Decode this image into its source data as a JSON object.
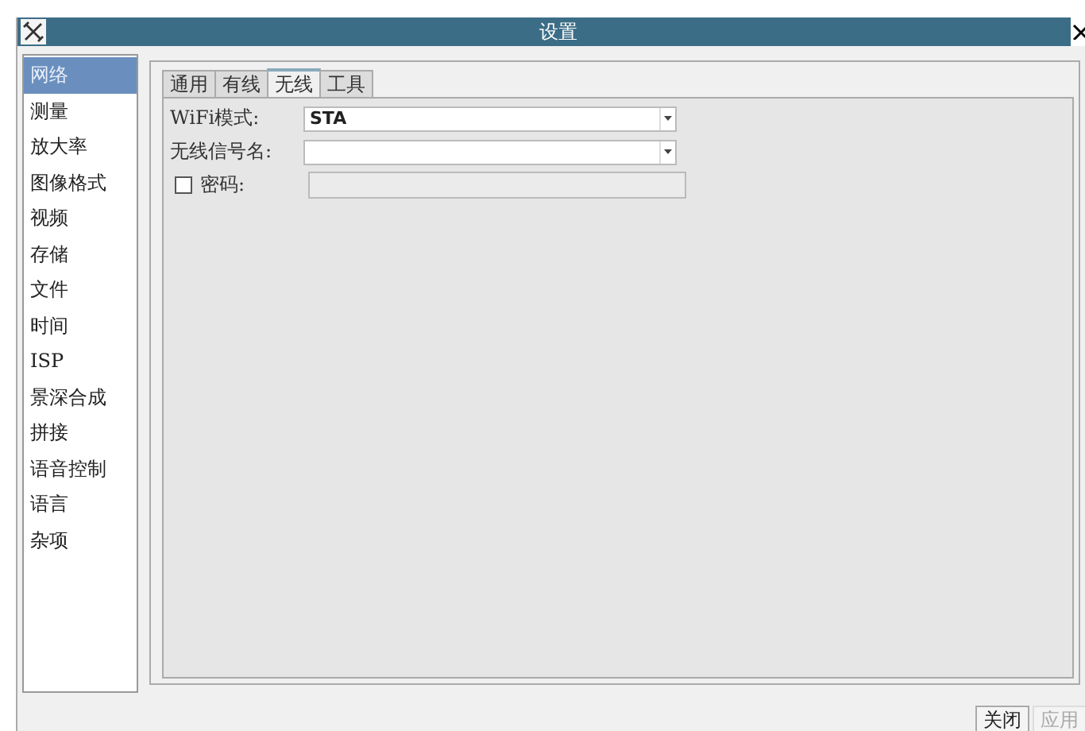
{
  "window": {
    "title": "设置"
  },
  "sidebar": {
    "items": [
      {
        "label": "网络",
        "selected": true
      },
      {
        "label": "测量",
        "selected": false
      },
      {
        "label": "放大率",
        "selected": false
      },
      {
        "label": "图像格式",
        "selected": false
      },
      {
        "label": "视频",
        "selected": false
      },
      {
        "label": "存储",
        "selected": false
      },
      {
        "label": "文件",
        "selected": false
      },
      {
        "label": "时间",
        "selected": false
      },
      {
        "label": "ISP",
        "selected": false
      },
      {
        "label": "景深合成",
        "selected": false
      },
      {
        "label": "拼接",
        "selected": false
      },
      {
        "label": "语音控制",
        "selected": false
      },
      {
        "label": "语言",
        "selected": false
      },
      {
        "label": "杂项",
        "selected": false
      }
    ]
  },
  "tabs": [
    {
      "label": "通用",
      "selected": false
    },
    {
      "label": "有线",
      "selected": false
    },
    {
      "label": "无线",
      "selected": true
    },
    {
      "label": "工具",
      "selected": false
    }
  ],
  "form": [
    {
      "kind": "dropdown",
      "label": "WiFi模式:",
      "value": "STA"
    },
    {
      "kind": "dropdown",
      "label": "无线信号名:"
    },
    {
      "kind": "checkbox-field",
      "label": "密码:",
      "checked": false,
      "disabled": true
    }
  ],
  "buttons": [
    {
      "label": "关闭",
      "disabled": false
    },
    {
      "label": "应用",
      "disabled": true
    }
  ]
}
